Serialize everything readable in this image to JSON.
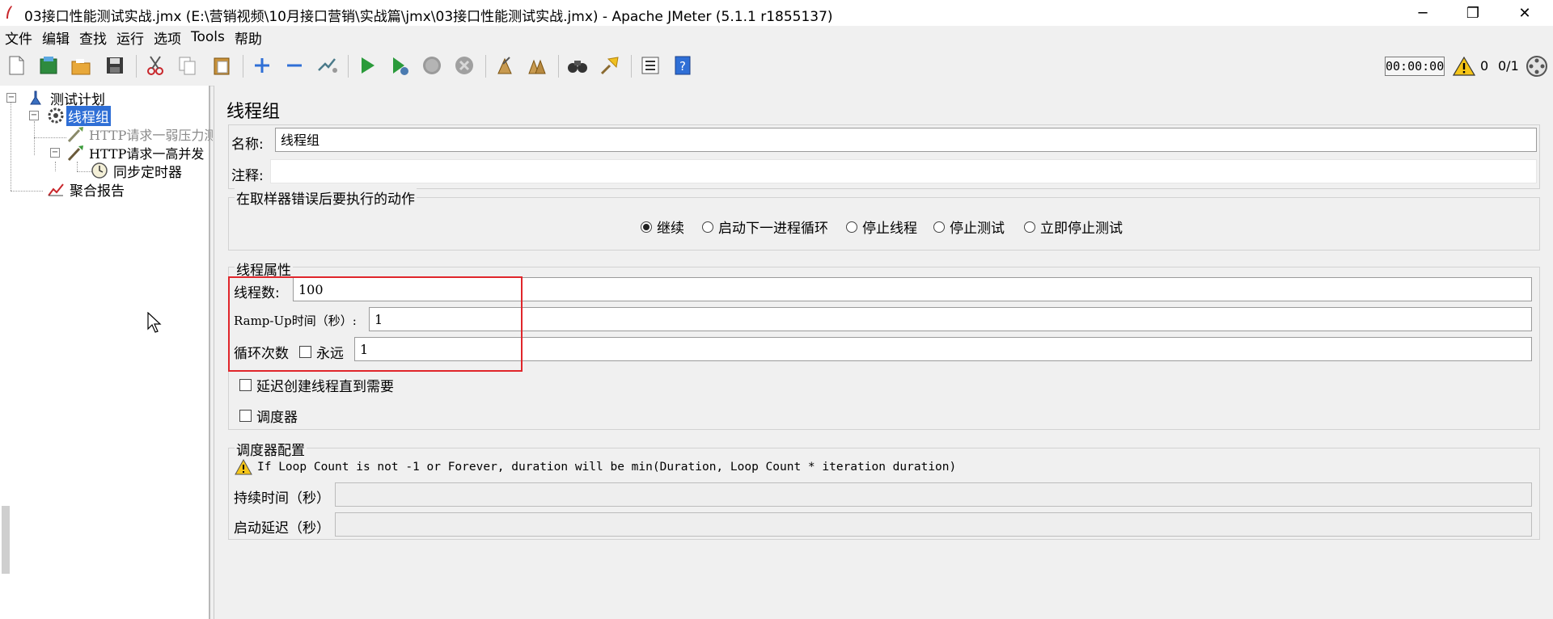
{
  "window": {
    "title": "03接口性能测试实战.jmx (E:\\营销视频\\10月接口营销\\实战篇\\jmx\\03接口性能测试实战.jmx) - Apache JMeter (5.1.1 r1855137)",
    "minimize": "─",
    "restore": "❐",
    "close": "✕"
  },
  "menu": [
    "文件",
    "编辑",
    "查找",
    "运行",
    "选项",
    "Tools",
    "帮助"
  ],
  "toolbar": {
    "icons": [
      "new-icon",
      "templates-icon",
      "open-icon",
      "save-icon",
      "cut-icon",
      "copy-icon",
      "paste-icon",
      "expand-icon",
      "collapse-icon",
      "toggle-icon",
      "start-icon",
      "start-no-pause-icon",
      "stop-icon",
      "shutdown-icon",
      "clear-icon",
      "clear-all-icon",
      "search-icon",
      "reset-search-icon",
      "function-helper-icon",
      "help-icon"
    ],
    "timer": "00:00:00",
    "warning_count": "0",
    "thread_count": "0/1"
  },
  "tree": {
    "items": [
      {
        "label": "测试计划",
        "icon": "test-plan-icon"
      },
      {
        "label": "线程组",
        "icon": "thread-group-icon",
        "selected": true
      },
      {
        "label": "HTTP请求一弱压力测",
        "icon": "sampler-icon",
        "disabled": true
      },
      {
        "label": "HTTP请求一高并发",
        "icon": "sampler-icon"
      },
      {
        "label": "同步定时器",
        "icon": "timer-icon"
      },
      {
        "label": "聚合报告",
        "icon": "report-icon"
      }
    ]
  },
  "panel": {
    "title": "线程组",
    "name_label": "名称:",
    "name_value": "线程组",
    "comment_label": "注释:",
    "comment_value": "",
    "error_action": {
      "legend": "在取样器错误后要执行的动作",
      "options": [
        "继续",
        "启动下一进程循环",
        "停止线程",
        "停止测试",
        "立即停止测试"
      ],
      "selected": "继续"
    },
    "thread_props": {
      "legend": "线程属性",
      "threads_label": "线程数:",
      "threads_value": "100",
      "rampup_label": "Ramp-Up时间（秒）:",
      "rampup_value": "1",
      "loop_label": "循环次数",
      "forever_label": "永远",
      "loop_value": "1",
      "delay_label": "延迟创建线程直到需要",
      "scheduler_label": "调度器"
    },
    "scheduler_config": {
      "legend": "调度器配置",
      "warning": "If Loop Count is not -1 or Forever, duration will be min(Duration, Loop Count * iteration duration)",
      "duration_label": "持续时间（秒）",
      "duration_value": "",
      "delay_label": "启动延迟（秒）",
      "delay_value": ""
    }
  }
}
